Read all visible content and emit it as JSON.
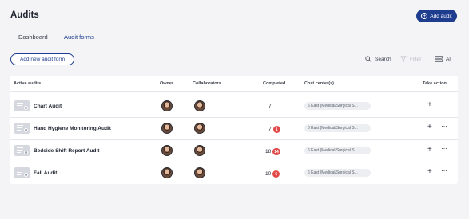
{
  "header": {
    "title": "Audits",
    "add_button_label": "Add audit"
  },
  "tabs": [
    {
      "label": "Dashboard",
      "active": false
    },
    {
      "label": "Audit forms",
      "active": true
    }
  ],
  "toolbar": {
    "new_form_label": "Add new audit form",
    "search_label": "Search",
    "filter_label": "Filter",
    "view_label": "All"
  },
  "table": {
    "columns": [
      "Active audits",
      "Owner",
      "Collaborators",
      "Completed",
      "Cost center(s)",
      "Take action"
    ],
    "rows": [
      {
        "name": "Chart Audit",
        "completed": "7",
        "badge": "",
        "cost_center": "6 East (Medical/Surgical S..."
      },
      {
        "name": "Hand Hygiene Monitoring Audit",
        "completed": "7",
        "badge": "1",
        "cost_center": "6 East (Medical/Surgical S..."
      },
      {
        "name": "Bedside Shift Report Audit",
        "completed": "18",
        "badge": "14",
        "cost_center": "6 East (Medical/Surgical S..."
      },
      {
        "name": "Fall Audit",
        "completed": "10",
        "badge": "6",
        "cost_center": "6 East (Medical/Surgical S..."
      }
    ]
  },
  "colors": {
    "primary": "#1f3d8f",
    "badge": "#e24a4a",
    "background": "#f4f4f6"
  }
}
